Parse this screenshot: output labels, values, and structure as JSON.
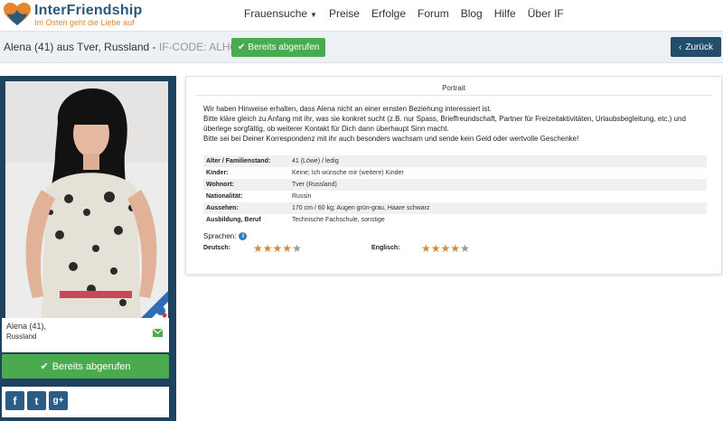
{
  "brand": {
    "title": "InterFriendship",
    "tagline": "Im Osten geht die Liebe auf"
  },
  "nav": {
    "items": [
      "Frauensuche",
      "Preise",
      "Erfolge",
      "Forum",
      "Blog",
      "Hilfe",
      "Über IF"
    ]
  },
  "profile_header": {
    "title": "Alena (41) aus Tver, Russland - ",
    "code": "IF-CODE: ALH040",
    "status_button": "Bereits abgerufen",
    "back_button": "Zurück"
  },
  "sidebar": {
    "name": "Alena (41),",
    "country": "Russland",
    "button": "Bereits abgerufen",
    "social": [
      "f",
      "t",
      "g+"
    ]
  },
  "portrait": {
    "title": "Portrait",
    "warning": [
      "Wir haben Hinweise erhalten, dass Alena nicht an einer ernsten Beziehung interessiert ist.",
      "Bitte kläre gleich zu Anfang mit ihr, was sie konkret sucht (z.B. nur Spass, Brieffreundschaft, Partner für Freizeitaktivitäten, Urlaubsbegleitung, etc.) und überlege sorgfältig, ob weiterer Kontakt für Dich dann überhaupt Sinn macht.",
      "Bitte sei bei Deiner Korrespondenz mit ihr auch besonders wachsam und sende kein Geld oder wertvolle Geschenke!"
    ],
    "facts": [
      {
        "label": "Alter / Familienstand:",
        "value": "41 (Löwe) / ledig"
      },
      {
        "label": "Kinder:",
        "value": "Keine; Ich wünsche mir (weitere) Kinder"
      },
      {
        "label": "Wohnort:",
        "value": "Tver (Russland)"
      },
      {
        "label": "Nationalität:",
        "value": "Russin"
      },
      {
        "label": "Aussehen:",
        "value": "170 cm / 60 kg; Augen grün-grau, Haare schwarz"
      },
      {
        "label": "Ausbildung, Beruf",
        "value": "Technische Fachschule, sonstige"
      }
    ],
    "languages_label": "Sprachen:",
    "languages": [
      {
        "name": "Deutsch:",
        "rating": 4,
        "max": 5
      },
      {
        "name": "Englisch:",
        "rating": 4,
        "max": 5
      }
    ]
  },
  "colors": {
    "brand_blue": "#1d4360",
    "accent_orange": "#e3872e",
    "green": "#4aab4e"
  }
}
